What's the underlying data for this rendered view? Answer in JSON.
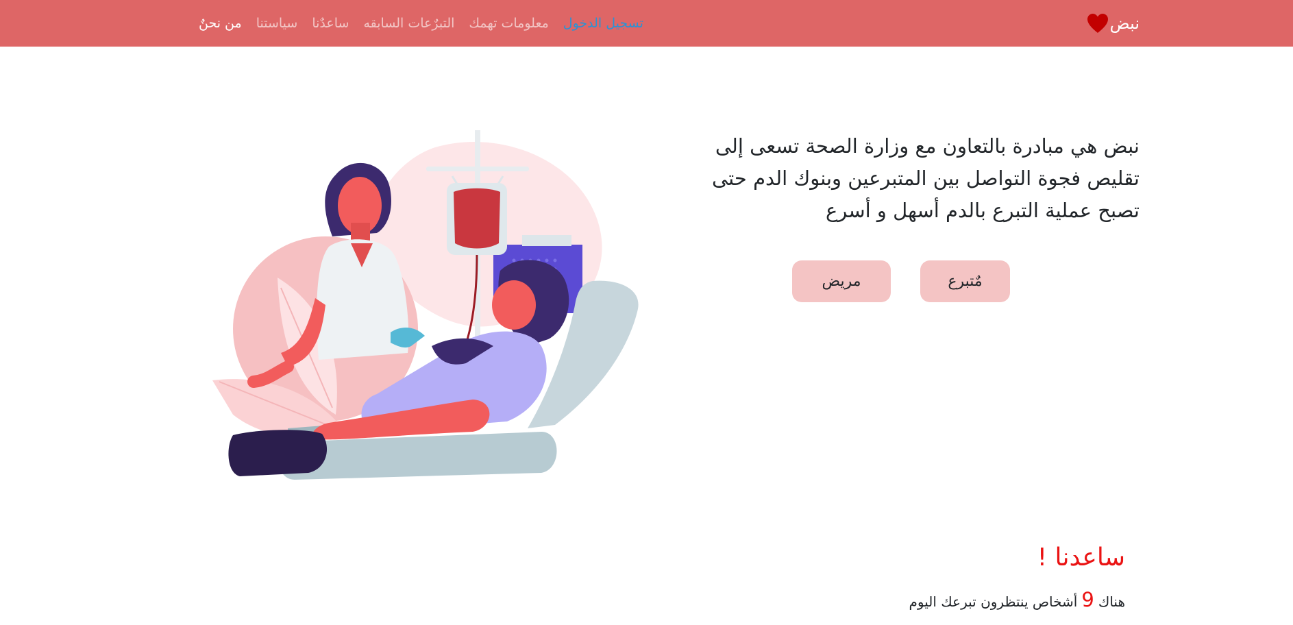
{
  "navbar": {
    "brand": {
      "label": "نبض",
      "icon": "heart-icon",
      "icon_color": "#c20000"
    },
    "links": [
      {
        "label": "من نحنٌ",
        "active": true
      },
      {
        "label": "سياستنا"
      },
      {
        "label": "ساعدٌنا"
      },
      {
        "label": "التبرٌعات السابقه"
      },
      {
        "label": "معلومات تهمك"
      },
      {
        "label": "تسجيل الدخول",
        "color": "#2a93d5"
      }
    ],
    "background": "#de6666"
  },
  "hero": {
    "text": "نبض هي مبادرة بالتعاون مع وزارة الصحة تسعى إلى تقليص فجوة التواصل بين المتبرعين وبنوك الدم حتى تصبح عملية التبرع بالدم أسهل و أسرع",
    "buttons": {
      "donor": "مٌتبرع",
      "patient": "مريض"
    },
    "illustration": "blood-donation-illustration"
  },
  "help": {
    "title": "ساعدنا !",
    "prefix": "هناك",
    "count": "9",
    "suffix": "أشخاص ينتظرون تبرعك اليوم",
    "accent": "#ea1313"
  }
}
